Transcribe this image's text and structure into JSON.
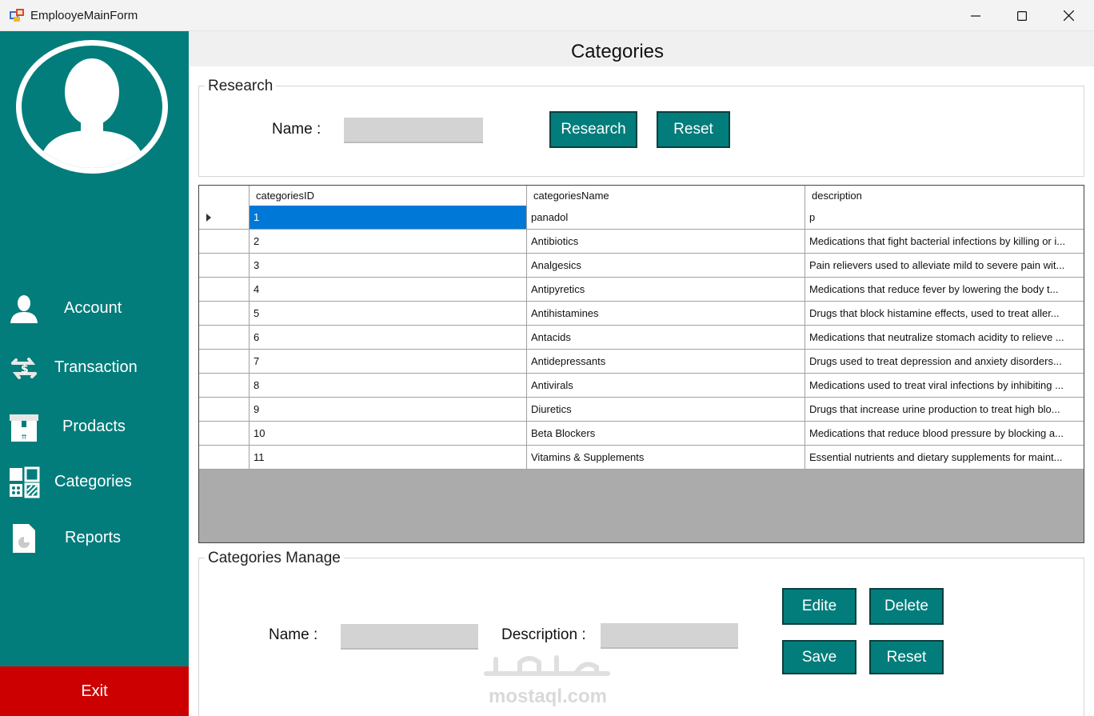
{
  "window": {
    "title": "EmplooyeMainForm"
  },
  "sidebar": {
    "items": [
      {
        "label": "Account",
        "icon": "user-icon"
      },
      {
        "label": "Transaction",
        "icon": "exchange-arrows-icon"
      },
      {
        "label": "Prodacts",
        "icon": "box-icon"
      },
      {
        "label": "Categories",
        "icon": "categories-grid-icon"
      },
      {
        "label": "Reports",
        "icon": "report-document-icon"
      }
    ],
    "exit_label": "Exit"
  },
  "page": {
    "title": "Categories"
  },
  "research": {
    "legend": "Research",
    "name_label": "Name :",
    "name_value": "",
    "research_button": "Research",
    "reset_button": "Reset"
  },
  "grid": {
    "columns": [
      "categoriesID",
      "categoriesName",
      "description"
    ],
    "selected_row": 0,
    "rows": [
      {
        "id": "1",
        "name": "panadol",
        "description": "p"
      },
      {
        "id": "2",
        "name": "Antibiotics",
        "description": "Medications that fight bacterial infections by killing or i..."
      },
      {
        "id": "3",
        "name": "Analgesics",
        "description": "Pain relievers used to alleviate mild to severe pain wit..."
      },
      {
        "id": "4",
        "name": "Antipyretics",
        "description": "Medications that reduce fever by lowering the body t..."
      },
      {
        "id": "5",
        "name": "Antihistamines",
        "description": "Drugs that block histamine effects, used to treat aller..."
      },
      {
        "id": "6",
        "name": "Antacids",
        "description": "Medications that neutralize stomach acidity to relieve ..."
      },
      {
        "id": "7",
        "name": "Antidepressants",
        "description": "Drugs used to treat depression and anxiety disorders..."
      },
      {
        "id": "8",
        "name": "Antivirals",
        "description": "Medications used to treat viral infections by inhibiting ..."
      },
      {
        "id": "9",
        "name": "Diuretics",
        "description": "Drugs that increase urine production to treat high blo..."
      },
      {
        "id": "10",
        "name": "Beta Blockers",
        "description": "Medications that reduce blood pressure by blocking a..."
      },
      {
        "id": "11",
        "name": "Vitamins & Supplements",
        "description": "Essential nutrients and dietary supplements for maint..."
      }
    ]
  },
  "manage": {
    "legend": "Categories Manage",
    "name_label": "Name :",
    "name_value": "",
    "description_label": "Description :",
    "description_value": "",
    "edit_button": "Edite",
    "delete_button": "Delete",
    "save_button": "Save",
    "reset_button": "Reset"
  },
  "watermark": {
    "text": "mostaql.com"
  },
  "colors": {
    "teal": "#027d7b",
    "exit_red": "#cc0000",
    "selection_blue": "#0078d7",
    "grid_empty": "#ababab"
  }
}
